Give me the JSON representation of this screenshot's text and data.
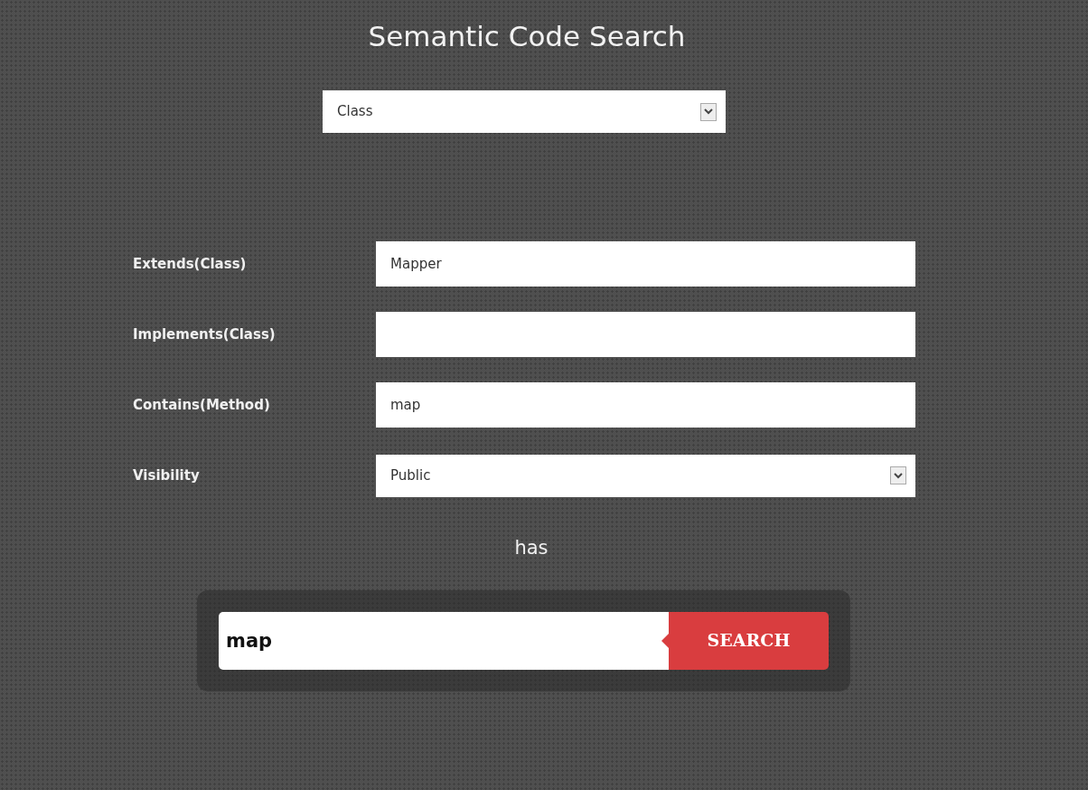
{
  "title": "Semantic Code Search",
  "type_select": {
    "value": "Class"
  },
  "fields": [
    {
      "label": "Extends(Class)",
      "kind": "text",
      "value": "Mapper"
    },
    {
      "label": "Implements(Class)",
      "kind": "text"
    },
    {
      "label": "Contains(Method)",
      "kind": "text",
      "value": "map"
    },
    {
      "label": "Visibility",
      "kind": "select",
      "value": "Public"
    }
  ],
  "connector": "has",
  "search": {
    "value": "map",
    "button": "SEARCH"
  }
}
